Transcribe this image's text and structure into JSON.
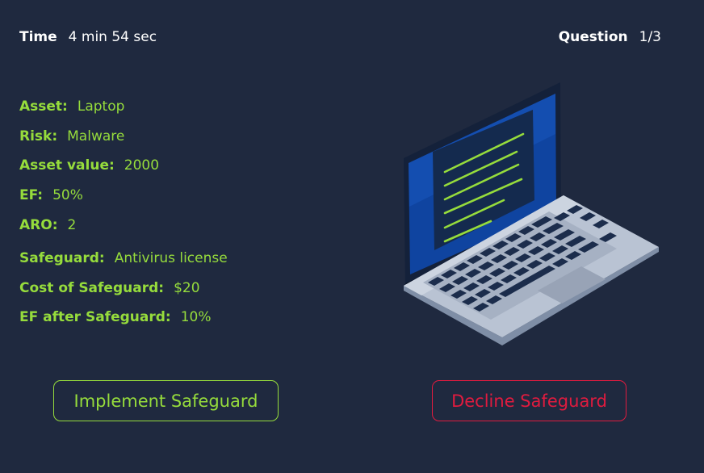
{
  "header": {
    "time_label": "Time",
    "time_value": "4 min 54 sec",
    "question_label": "Question",
    "question_value": "1/3"
  },
  "scenario": {
    "asset_label": "Asset:",
    "asset_value": "Laptop",
    "risk_label": "Risk:",
    "risk_value": "Malware",
    "asset_value_label": "Asset value:",
    "asset_value_value": "2000",
    "ef_label": "EF:",
    "ef_value": "50%",
    "aro_label": "ARO:",
    "aro_value": "2",
    "safeguard_label": "Safeguard:",
    "safeguard_value": "Antivirus license",
    "cost_label": "Cost of Safeguard:",
    "cost_value": "$20",
    "ef_after_label": "EF after Safeguard:",
    "ef_after_value": "10%"
  },
  "actions": {
    "implement_label": "Implement Safeguard",
    "decline_label": "Decline Safeguard"
  },
  "illustration": {
    "icon": "laptop-icon"
  },
  "colors": {
    "background": "#1f293f",
    "accent_green": "#96dc3c",
    "accent_red": "#e01b3f",
    "text_white": "#ffffff"
  }
}
